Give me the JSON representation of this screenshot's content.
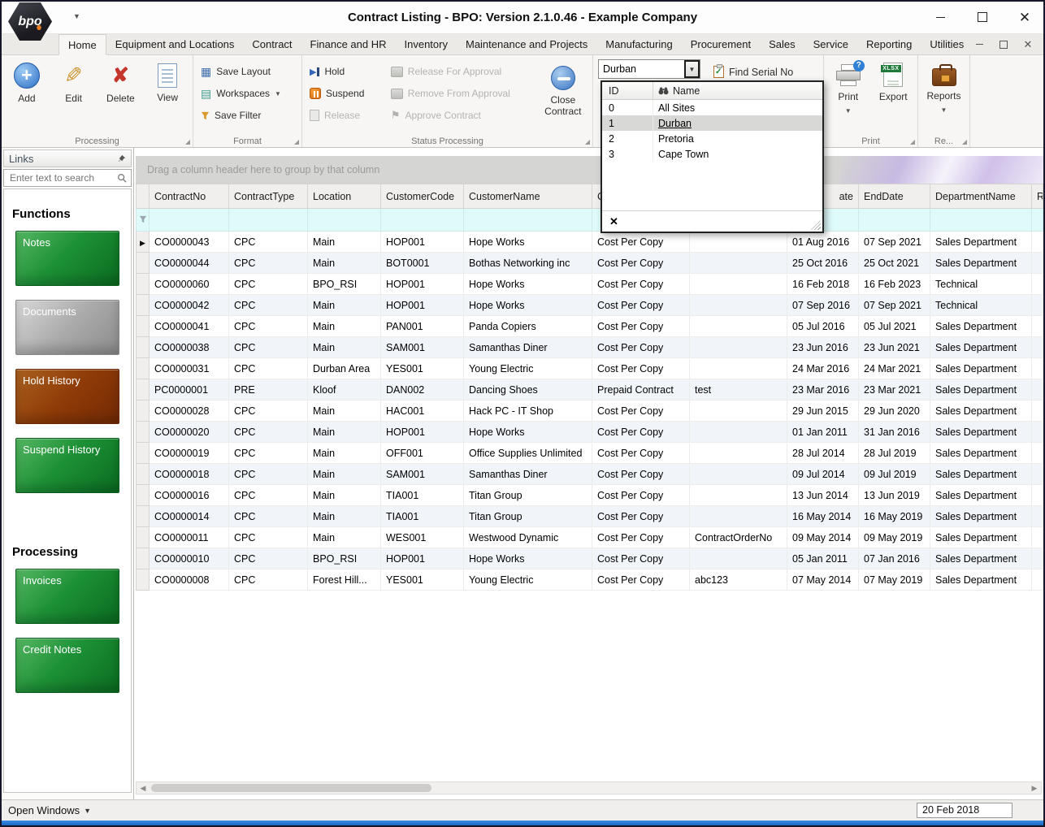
{
  "window": {
    "title": "Contract Listing - BPO: Version 2.1.0.46 - Example Company",
    "logo": "bpo"
  },
  "tabs": [
    "Home",
    "Equipment and Locations",
    "Contract",
    "Finance and HR",
    "Inventory",
    "Maintenance and Projects",
    "Manufacturing",
    "Procurement",
    "Sales",
    "Service",
    "Reporting",
    "Utilities"
  ],
  "selected_tab": "Home",
  "ribbon": {
    "processing": {
      "label": "Processing",
      "add": "Add",
      "edit": "Edit",
      "delete": "Delete",
      "view": "View"
    },
    "format": {
      "label": "Format",
      "save_layout": "Save Layout",
      "workspaces": "Workspaces",
      "save_filter": "Save Filter"
    },
    "status": {
      "label": "Status Processing",
      "hold": "Hold",
      "suspend": "Suspend",
      "release": "Release",
      "release_for_approval": "Release For Approval",
      "remove_from_approval": "Remove From Approval",
      "approve_contract": "Approve Contract",
      "close_contract": "Close Contract"
    },
    "site_filter": {
      "value": "Durban"
    },
    "find_serial_label": "Find Serial No",
    "print_group": {
      "label": "Print",
      "print": "Print",
      "export": "Export"
    },
    "reports_group": {
      "label": "Re...",
      "reports": "Reports"
    }
  },
  "site_dropdown": {
    "id_header": "ID",
    "name_header": "Name",
    "options": [
      {
        "id": "0",
        "name": "All Sites",
        "selected": false
      },
      {
        "id": "1",
        "name": "Durban",
        "selected": true
      },
      {
        "id": "2",
        "name": "Pretoria",
        "selected": false
      },
      {
        "id": "3",
        "name": "Cape Town",
        "selected": false
      }
    ]
  },
  "sidebar": {
    "title": "Links",
    "search_placeholder": "Enter text to search",
    "functions_heading": "Functions",
    "processing_heading": "Processing",
    "function_buttons": [
      {
        "label": "Notes",
        "color": "green"
      },
      {
        "label": "Documents",
        "color": "gray"
      },
      {
        "label": "Hold History",
        "color": "rust"
      },
      {
        "label": "Suspend History",
        "color": "green"
      }
    ],
    "processing_buttons": [
      {
        "label": "Invoices",
        "color": "green"
      },
      {
        "label": "Credit Notes",
        "color": "green"
      }
    ]
  },
  "grid": {
    "group_hint": "Drag a column header here to group by that column",
    "columns": [
      "ContractNo",
      "ContractType",
      "Location",
      "CustomerCode",
      "CustomerName",
      "C",
      "",
      "ate",
      "EndDate",
      "DepartmentName",
      "R"
    ],
    "rows": [
      [
        "CO0000043",
        "CPC",
        "Main",
        "HOP001",
        "Hope Works",
        "Cost Per Copy",
        "",
        "01 Aug 2016",
        "07 Sep 2021",
        "Sales Department",
        ""
      ],
      [
        "CO0000044",
        "CPC",
        "Main",
        "BOT0001",
        "Bothas Networking inc",
        "Cost Per Copy",
        "",
        "25 Oct 2016",
        "25 Oct 2021",
        "Sales Department",
        ""
      ],
      [
        "CO0000060",
        "CPC",
        "BPO_RSI",
        "HOP001",
        "Hope Works",
        "Cost Per Copy",
        "",
        "16 Feb 2018",
        "16 Feb 2023",
        "Technical",
        ""
      ],
      [
        "CO0000042",
        "CPC",
        "Main",
        "HOP001",
        "Hope Works",
        "Cost Per Copy",
        "",
        "07 Sep 2016",
        "07 Sep 2021",
        "Technical",
        ""
      ],
      [
        "CO0000041",
        "CPC",
        "Main",
        "PAN001",
        "Panda Copiers",
        "Cost Per Copy",
        "",
        "05 Jul 2016",
        "05 Jul 2021",
        "Sales Department",
        ""
      ],
      [
        "CO0000038",
        "CPC",
        "Main",
        "SAM001",
        "Samanthas Diner",
        "Cost Per Copy",
        "",
        "23 Jun 2016",
        "23 Jun 2021",
        "Sales Department",
        ""
      ],
      [
        "CO0000031",
        "CPC",
        "Durban Area",
        "YES001",
        "Young Electric",
        "Cost Per Copy",
        "",
        "24 Mar 2016",
        "24 Mar 2021",
        "Sales Department",
        ""
      ],
      [
        "PC0000001",
        "PRE",
        "Kloof",
        "DAN002",
        "Dancing Shoes",
        "Prepaid Contract",
        "test",
        "23 Mar 2016",
        "23 Mar 2021",
        "Sales Department",
        ""
      ],
      [
        "CO0000028",
        "CPC",
        "Main",
        "HAC001",
        "Hack PC - IT Shop",
        "Cost Per Copy",
        "",
        "29 Jun 2015",
        "29 Jun 2020",
        "Sales Department",
        ""
      ],
      [
        "CO0000020",
        "CPC",
        "Main",
        "HOP001",
        "Hope Works",
        "Cost Per Copy",
        "",
        "01 Jan 2011",
        "31 Jan 2016",
        "Sales Department",
        ""
      ],
      [
        "CO0000019",
        "CPC",
        "Main",
        "OFF001",
        "Office Supplies Unlimited",
        "Cost Per Copy",
        "",
        "28 Jul 2014",
        "28 Jul 2019",
        "Sales Department",
        ""
      ],
      [
        "CO0000018",
        "CPC",
        "Main",
        "SAM001",
        "Samanthas Diner",
        "Cost Per Copy",
        "",
        "09 Jul 2014",
        "09 Jul 2019",
        "Sales Department",
        ""
      ],
      [
        "CO0000016",
        "CPC",
        "Main",
        "TIA001",
        "Titan Group",
        "Cost Per Copy",
        "",
        "13 Jun 2014",
        "13 Jun 2019",
        "Sales Department",
        ""
      ],
      [
        "CO0000014",
        "CPC",
        "Main",
        "TIA001",
        "Titan Group",
        "Cost Per Copy",
        "",
        "16 May 2014",
        "16 May 2019",
        "Sales Department",
        ""
      ],
      [
        "CO0000011",
        "CPC",
        "Main",
        "WES001",
        "Westwood Dynamic",
        "Cost Per Copy",
        "ContractOrderNo",
        "09 May 2014",
        "09 May 2019",
        "Sales Department",
        ""
      ],
      [
        "CO0000010",
        "CPC",
        "BPO_RSI",
        "HOP001",
        "Hope Works",
        "Cost Per Copy",
        "",
        "05 Jan 2011",
        "07 Jan 2016",
        "Sales Department",
        ""
      ],
      [
        "CO0000008",
        "CPC",
        "Forest Hill...",
        "YES001",
        "Young Electric",
        "Cost Per Copy",
        "abc123",
        "07 May 2014",
        "07 May 2019",
        "Sales Department",
        ""
      ]
    ]
  },
  "status_bar": {
    "open_windows": "Open Windows",
    "date": "20 Feb 2018"
  },
  "colors": {
    "accent_blue": "#2178d4",
    "filter_row": "#defbfa",
    "green_button": "#1d9136",
    "rust_button": "#903b07",
    "gray_button": "#ababab"
  }
}
